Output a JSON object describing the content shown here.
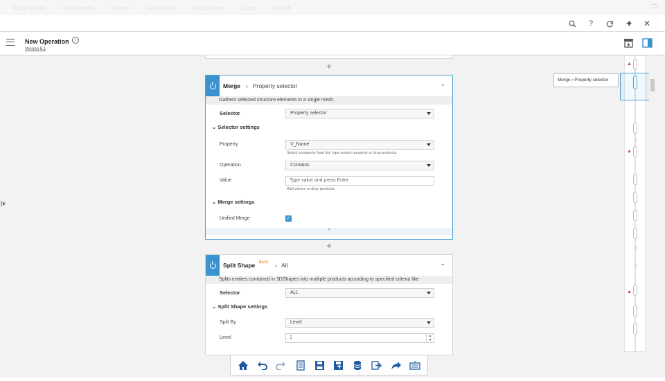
{
  "topnav": {
    "items": [
      "Subscriptions",
      "Components",
      "Content",
      "Dashboards",
      "Vocabularies",
      "Logon",
      "Search"
    ]
  },
  "header": {
    "icons": [
      "search-icon",
      "help-icon",
      "refresh-icon",
      "pin-icon",
      "close-icon"
    ],
    "help_glyph": "?",
    "close_glyph": "✕"
  },
  "titlebar": {
    "title": "New Operation",
    "info_glyph": "i",
    "version": "Version 6.1"
  },
  "merge": {
    "title": "Merge",
    "breadcrumb_sep": "›",
    "subtitle": "Property selector",
    "chevron": "⌄",
    "description": "Gathers selected structure elements in a single mesh.",
    "selector_label": "Selector",
    "selector_value": "Property selector",
    "selector_settings_title": "Selector settings",
    "property_label": "Property",
    "property_value": "V_Name",
    "property_hint": "Select a property from list, type custom property or  drop products",
    "operation_label": "Operation",
    "operation_value": "Contains",
    "value_label": "Value",
    "value_placeholder": "Type value and press Enter",
    "value_hint": "Add values or  drop products",
    "merge_settings_title": "Merge settings",
    "unified_merge_label": "Unified Merge",
    "unified_merge_checked": true
  },
  "split": {
    "title": "Split Shape",
    "beta": "BETA",
    "breadcrumb_sep": "›",
    "subtitle": "All",
    "chevron": "⌄",
    "description": "Splits entities contained in 3DShapes into multiple products according to specified criteria like",
    "selector_label": "Selector",
    "selector_value": "ALL",
    "settings_title": "Split Shape settings",
    "split_by_label": "Split By",
    "split_by_value": "Level",
    "level_label": "Level",
    "level_value": "1"
  },
  "collapse_glyph": "^",
  "add_glyph": "+",
  "expand_glyph": "⌄",
  "tooltip": {
    "text": "Merge  ›  Property selector"
  },
  "toolbar": {
    "icons": [
      "home-icon",
      "undo-icon",
      "redo-icon",
      "properties-icon",
      "save-icon",
      "save-as-icon",
      "database-icon",
      "export-icon",
      "share-icon",
      "keyboard-icon"
    ]
  },
  "colors": {
    "accent": "#3993cf",
    "warning": "#d9332f",
    "beta": "#e8903b"
  }
}
